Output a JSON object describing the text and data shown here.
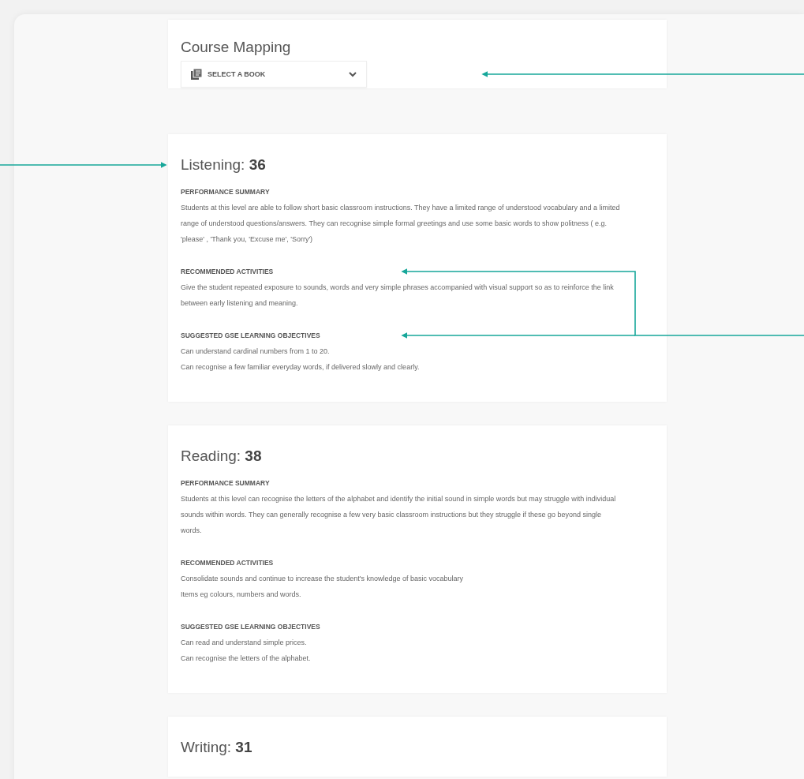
{
  "course_mapping": {
    "title": "Course Mapping",
    "book_select": {
      "placeholder": "SELECT A BOOK"
    }
  },
  "skills": [
    {
      "name": "Listening:",
      "score": "36",
      "sections": [
        {
          "heading": "PERFORMANCE SUMMARY",
          "lines": [
            "Students at this level are able to follow short basic classroom instructions. They have a limited range of understood vocabulary and a limited range of understood questions/answers.  They can recognise simple formal greetings and use some basic words to show politness ( e.g. 'please' , 'Thank you, 'Excuse me', 'Sorry')"
          ]
        },
        {
          "heading": "RECOMMENDED ACTIVITIES",
          "lines": [
            "Give the student repeated exposure to sounds, words and very simple phrases accompanied with visual support so as to reinforce the link between early listening and meaning."
          ]
        },
        {
          "heading": "SUGGESTED GSE LEARNING OBJECTIVES",
          "lines": [
            "Can understand cardinal numbers from 1 to 20.",
            "Can recognise a few familiar everyday words, if delivered slowly and clearly."
          ]
        }
      ]
    },
    {
      "name": "Reading:",
      "score": "38",
      "sections": [
        {
          "heading": "PERFORMANCE SUMMARY",
          "lines": [
            "Students at this level can recognise the letters of the alphabet and identify the initial sound in simple words but may struggle with individual sounds within words. They can generally recognise a few very basic classroom instructions but they struggle if these go beyond single words."
          ]
        },
        {
          "heading": "RECOMMENDED ACTIVITIES",
          "lines": [
            "Consolidate sounds and continue to increase the student's knowledge of basic vocabulary",
            "Items eg colours, numbers and words."
          ]
        },
        {
          "heading": "SUGGESTED GSE LEARNING OBJECTIVES",
          "lines": [
            "Can read and understand simple prices.",
            "Can recognise the letters of the alphabet."
          ]
        }
      ]
    },
    {
      "name": "Writing:",
      "score": "31"
    }
  ]
}
